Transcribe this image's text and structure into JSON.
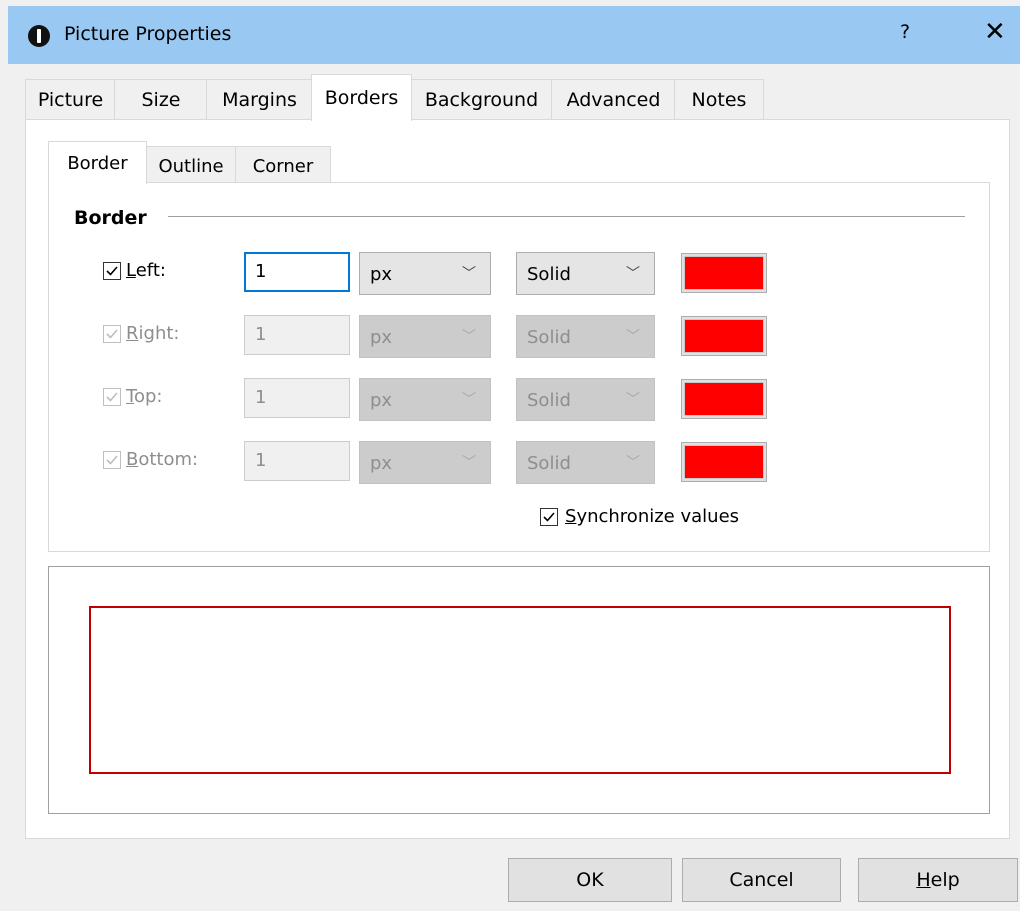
{
  "window": {
    "title": "Picture Properties",
    "help_glyph": "?",
    "close_glyph": "✕"
  },
  "tabs": [
    {
      "label": "Picture"
    },
    {
      "label": "Size"
    },
    {
      "label": "Margins"
    },
    {
      "label": "Borders"
    },
    {
      "label": "Background"
    },
    {
      "label": "Advanced"
    },
    {
      "label": "Notes"
    }
  ],
  "subtabs": [
    {
      "label": "Border"
    },
    {
      "label": "Outline"
    },
    {
      "label": "Corner"
    }
  ],
  "group": {
    "label": "Border"
  },
  "rows": [
    {
      "label_accel": "L",
      "label_rest": "eft:",
      "checked": true,
      "value": "1",
      "unit": "px",
      "style": "Solid",
      "color": "#ff0000"
    },
    {
      "label_accel": "R",
      "label_rest": "ight:",
      "checked": true,
      "value": "1",
      "unit": "px",
      "style": "Solid",
      "color": "#ff0000"
    },
    {
      "label_accel": "T",
      "label_rest": "op:",
      "checked": true,
      "value": "1",
      "unit": "px",
      "style": "Solid",
      "color": "#ff0000"
    },
    {
      "label_accel": "B",
      "label_rest": "ottom:",
      "checked": true,
      "value": "1",
      "unit": "px",
      "style": "Solid",
      "color": "#ff0000"
    }
  ],
  "sync": {
    "accel": "S",
    "rest": "ynchronize values",
    "checked": true
  },
  "buttons": {
    "ok": "OK",
    "cancel": "Cancel",
    "help_accel": "H",
    "help_rest": "elp"
  },
  "colors": {
    "titlebar": "#99c9f2",
    "preview_border": "#c00000",
    "swatch": "#ff0000"
  }
}
